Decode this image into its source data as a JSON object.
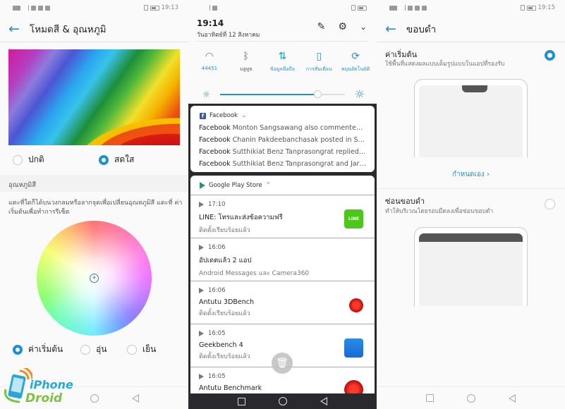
{
  "panel1": {
    "status": {
      "time": "19:13"
    },
    "title": "โหมดสี & อุณหภูมิ",
    "color_mode_options": [
      {
        "label": "ปกติ",
        "selected": false
      },
      {
        "label": "สดใส",
        "selected": true
      }
    ],
    "section_header": "อุณหภูมิสี",
    "description": "แตะที่ใดก็ได้บนวงกลมหรือลากจุดเพื่อเปลี่ยนอุณหภูมิสี แตะที่ ค่าเริ่มต้นเพื่อทำการรีเซ็ต",
    "temp_options": [
      {
        "label": "ค่าเริ่มต้น",
        "selected": true
      },
      {
        "label": "อุ่น",
        "selected": false
      },
      {
        "label": "เย็น",
        "selected": false
      }
    ],
    "watermark": {
      "line1": "iPhone",
      "line2": "Droid"
    }
  },
  "panel2": {
    "time": "19:14",
    "date": "วันอาทิตย์ที่ 12 สิงหาคม",
    "tiles": [
      {
        "icon": "wifi-icon",
        "label": "44451",
        "active": true
      },
      {
        "icon": "bluetooth-icon",
        "label": "บลูทูธ",
        "active": false
      },
      {
        "icon": "mobile-data-icon",
        "label": "ข้อมูลมือถือ",
        "active": true
      },
      {
        "icon": "vibrate-icon",
        "label": "การสั่นเตือน",
        "active": true
      },
      {
        "icon": "auto-rotate-icon",
        "label": "หมุนอัตโนมัติ",
        "active": true
      }
    ],
    "brightness": 0.78,
    "facebook": {
      "app": "Facebook",
      "lines": [
        {
          "app": "Facebook",
          "text": "Monton Sangsawang also commented…"
        },
        {
          "app": "Facebook",
          "text": "Chanin Pakdeebanchasak posted in Sa…"
        },
        {
          "app": "Facebook",
          "text": "Sutthikiat Benz Tanprasongrat replied t…"
        },
        {
          "app": "Facebook",
          "text": "Sutthikiat Benz Tanprasongrat and Jar…"
        }
      ]
    },
    "playstore": {
      "app": "Google Play Store",
      "items": [
        {
          "time": "17:10",
          "title": "LINE: โทรและส่งข้อความฟรี",
          "sub": "ติดตั้งเรียบร้อยแล้ว",
          "icon": "line"
        },
        {
          "time": "16:06",
          "title": "อัปเดตแล้ว 2 แอป",
          "sub": "Android Messages และ Camera360",
          "icon": ""
        },
        {
          "time": "16:06",
          "title": "Antutu 3DBench",
          "sub": "ติดตั้งเรียบร้อยแล้ว",
          "icon": "antutu"
        },
        {
          "time": "16:05",
          "title": "Geekbench 4",
          "sub": "ติดตั้งเรียบร้อยแล้ว",
          "icon": "geekbench"
        },
        {
          "time": "16:05",
          "title": "Antutu Benchmark",
          "sub": "",
          "icon": "antutu"
        }
      ]
    },
    "line_icon_text": "LINE"
  },
  "panel3": {
    "status": {
      "time": "19:15"
    },
    "title": "ขอบดำ",
    "options": [
      {
        "title": "ค่าเริ่มต้น",
        "desc": "ใช้พื้นที่แสดงผลแบบเต็มรูปแบบในแอปที่รองรับ",
        "selected": true
      },
      {
        "title": "ซ่อนขอบดำ",
        "desc": "ทำให้บริเวณโดยรอบมืดลงเพื่อซ่อนขอบดำ",
        "selected": false
      }
    ],
    "custom_link": "กำหนดเอง ›"
  }
}
